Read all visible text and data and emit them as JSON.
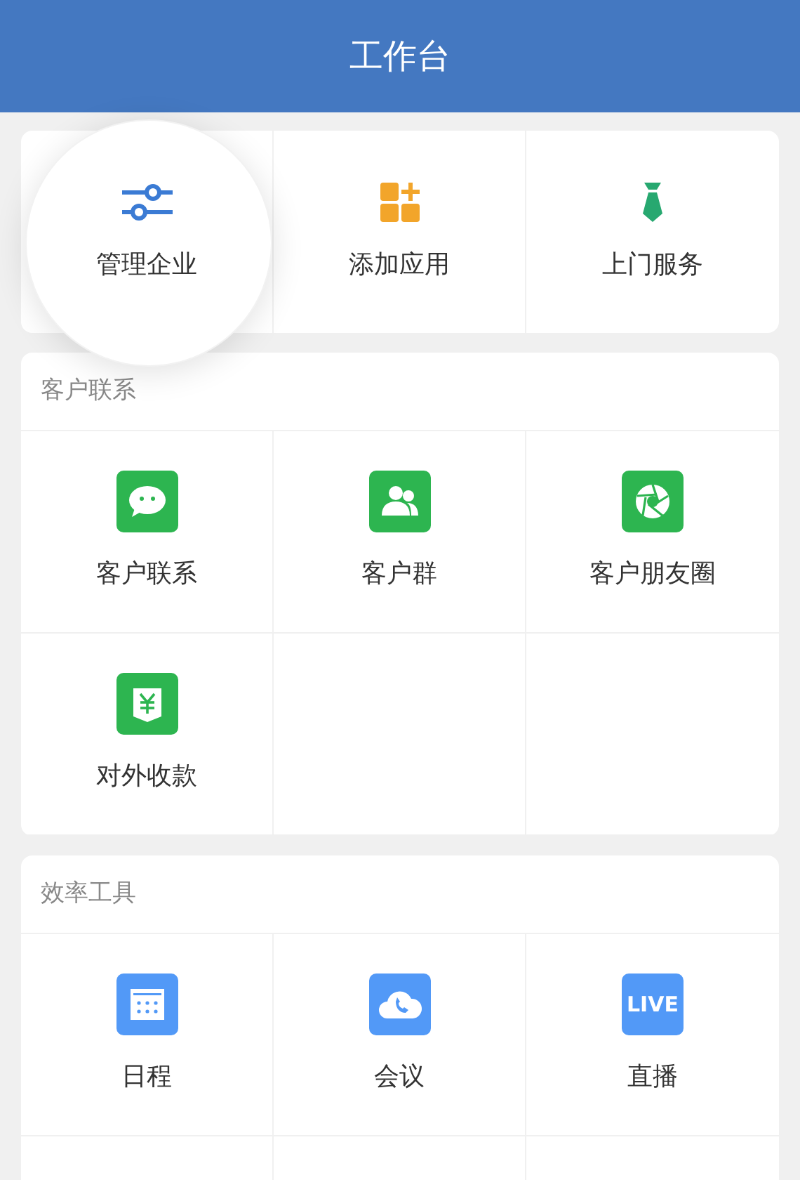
{
  "header": {
    "title": "工作台"
  },
  "quick_actions": [
    {
      "label": "管理企业",
      "highlighted": true
    },
    {
      "label": "添加应用",
      "highlighted": false
    },
    {
      "label": "上门服务",
      "highlighted": false
    }
  ],
  "sections": [
    {
      "title": "客户联系",
      "items": [
        {
          "label": "客户联系"
        },
        {
          "label": "客户群"
        },
        {
          "label": "客户朋友圈"
        },
        {
          "label": "对外收款"
        }
      ]
    },
    {
      "title": "效率工具",
      "items": [
        {
          "label": "日程"
        },
        {
          "label": "会议"
        },
        {
          "label": "直播",
          "icon_text": "LIVE"
        }
      ]
    }
  ]
}
